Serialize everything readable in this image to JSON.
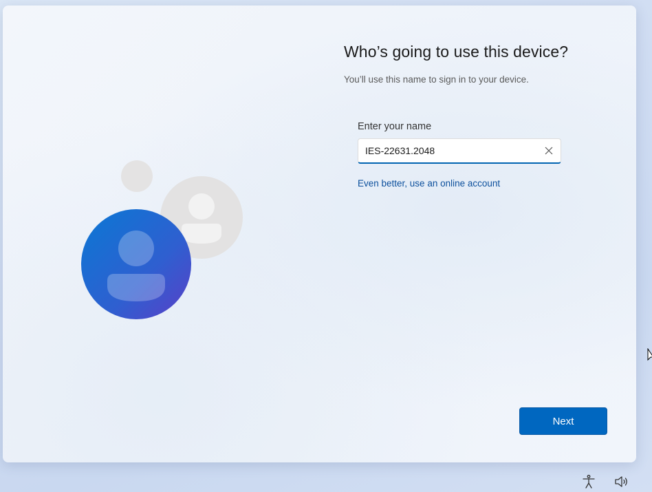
{
  "page": {
    "title": "Who’s going to use this device?",
    "subtitle": "You’ll use this name to sign in to your device."
  },
  "name_field": {
    "label": "Enter your name",
    "value": "IES-22631.2048",
    "clear_icon": "close-icon"
  },
  "links": {
    "online_account": "Even better, use an online account"
  },
  "footer": {
    "next_label": "Next"
  },
  "system_tray": {
    "icons": [
      "accessibility-icon",
      "volume-icon"
    ]
  },
  "colors": {
    "accent": "#0067c0",
    "link": "#0b4f9c",
    "avatar_gradient_start": "#0a78d4",
    "avatar_gradient_end": "#5a3fc7",
    "secondary_avatar": "#e3e2e2"
  }
}
